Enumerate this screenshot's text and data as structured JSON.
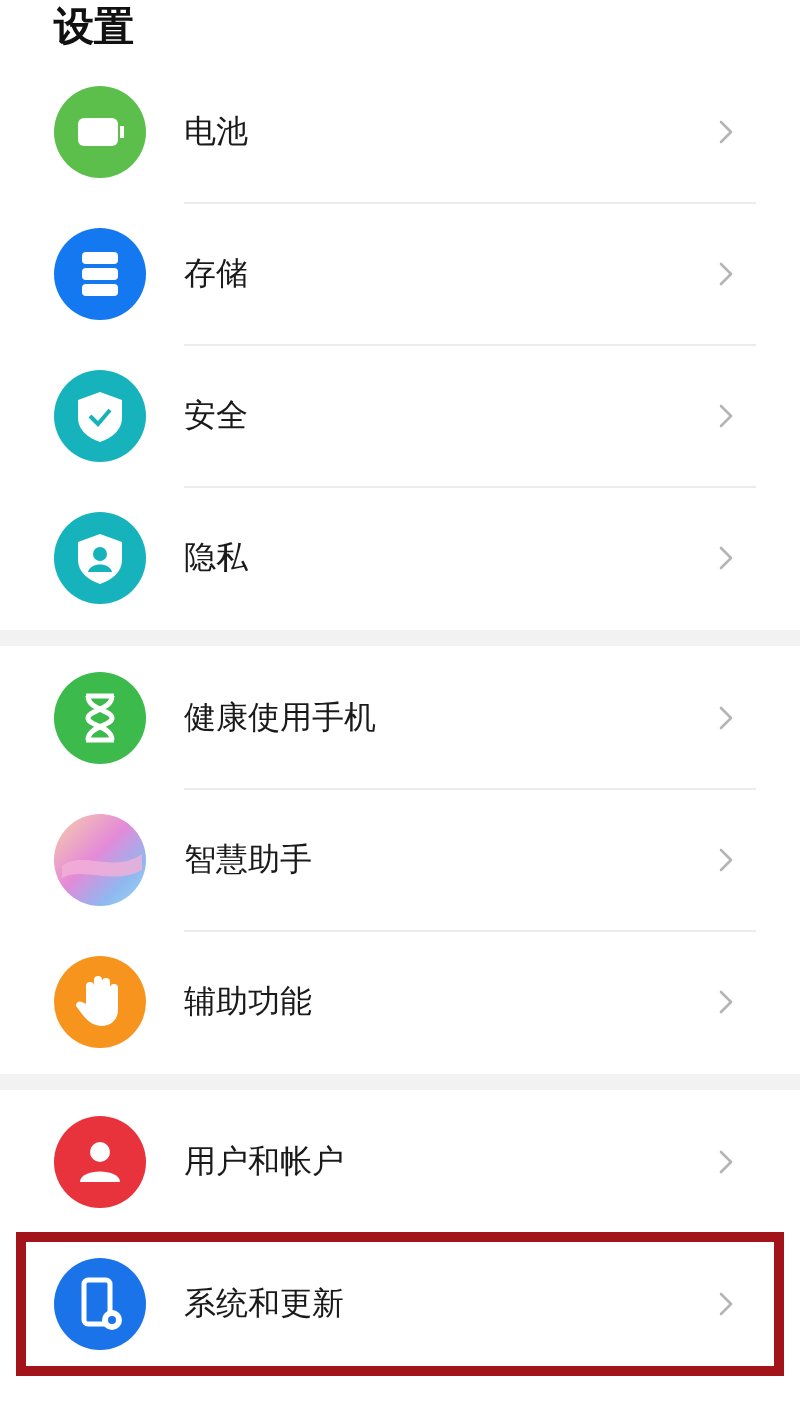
{
  "title": "设置",
  "groups": [
    {
      "items": [
        {
          "label": "电池",
          "highlighted": false
        },
        {
          "label": "存储",
          "highlighted": false
        },
        {
          "label": "安全",
          "highlighted": false
        },
        {
          "label": "隐私",
          "highlighted": false
        }
      ]
    },
    {
      "items": [
        {
          "label": "健康使用手机",
          "highlighted": false
        },
        {
          "label": "智慧助手",
          "highlighted": false
        },
        {
          "label": "辅助功能",
          "highlighted": false
        }
      ]
    },
    {
      "items": [
        {
          "label": "用户和帐户",
          "highlighted": false
        },
        {
          "label": "系统和更新",
          "highlighted": true
        }
      ]
    }
  ]
}
